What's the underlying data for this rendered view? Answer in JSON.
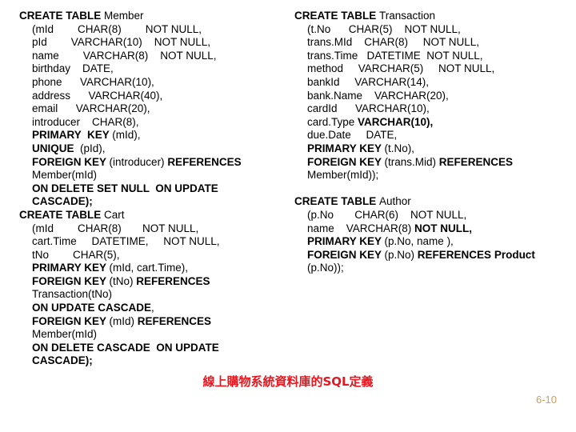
{
  "slide": {
    "caption": "線上購物系統資料庫的SQL定義",
    "page_number": "6-10",
    "caption_color": "#e8171f",
    "page_number_color": "#c8a060",
    "left_column": [
      {
        "indent": 0,
        "bold": "CREATE TABLE ",
        "normal": "Member"
      },
      {
        "indent": 1,
        "bold": "",
        "normal": "(mId        CHAR(8)        NOT NULL,"
      },
      {
        "indent": 1,
        "bold": "",
        "normal": "pId        VARCHAR(10)    NOT NULL,"
      },
      {
        "indent": 1,
        "bold": "",
        "normal": "name        VARCHAR(8)    NOT NULL,"
      },
      {
        "indent": 1,
        "bold": "",
        "normal": "birthday    DATE,"
      },
      {
        "indent": 1,
        "bold": "",
        "normal": "phone      VARCHAR(10),"
      },
      {
        "indent": 1,
        "bold": "",
        "normal": "address      VARCHAR(40),"
      },
      {
        "indent": 1,
        "bold": "",
        "normal": "email      VARCHAR(20),"
      },
      {
        "indent": 1,
        "bold": "",
        "normal": "introducer    CHAR(8),"
      },
      {
        "indent": 1,
        "bold": "PRIMARY  KEY ",
        "normal": "(mId),"
      },
      {
        "indent": 1,
        "bold": "UNIQUE ",
        "normal": " (pId),"
      },
      {
        "indent": 1,
        "bold": "FOREIGN KEY ",
        "normal": "(introducer) ",
        "bold2": "REFERENCES"
      },
      {
        "indent": 1,
        "bold": "",
        "normal": "Member(mId)"
      },
      {
        "indent": 1,
        "bold": "ON DELETE SET NULL  ON UPDATE",
        "normal": ""
      },
      {
        "indent": 1,
        "bold": "CASCADE);",
        "normal": ""
      },
      {
        "indent": 0,
        "bold": "CREATE TABLE ",
        "normal": "Cart"
      },
      {
        "indent": 1,
        "bold": "",
        "normal": "(mId        CHAR(8)       NOT NULL,"
      },
      {
        "indent": 1,
        "bold": "",
        "normal": "cart.Time     DATETIME,     NOT NULL,"
      },
      {
        "indent": 1,
        "bold": "",
        "normal": "tNo        CHAR(5),"
      },
      {
        "indent": 1,
        "bold": "PRIMARY KEY ",
        "normal": "(mId, cart.Time),"
      },
      {
        "indent": 1,
        "bold": "FOREIGN KEY ",
        "normal": "(tNo) ",
        "bold2": "REFERENCES"
      },
      {
        "indent": 1,
        "bold": "",
        "normal": "Transaction(tNo)"
      },
      {
        "indent": 1,
        "bold": "ON UPDATE CASCADE",
        "normal": ","
      },
      {
        "indent": 1,
        "bold": "FOREIGN KEY ",
        "normal": "(mId) ",
        "bold2": "REFERENCES"
      },
      {
        "indent": 1,
        "bold": "",
        "normal": "Member(mId)"
      },
      {
        "indent": 1,
        "bold": "ON DELETE CASCADE  ON UPDATE",
        "normal": ""
      },
      {
        "indent": 1,
        "bold": "CASCADE);",
        "normal": ""
      }
    ],
    "right_column": [
      {
        "indent": 0,
        "bold": "CREATE TABLE ",
        "normal": "Transaction"
      },
      {
        "indent": 1,
        "bold": "",
        "normal": "(t.No      CHAR(5)    NOT NULL,"
      },
      {
        "indent": 1,
        "bold": "",
        "normal": "trans.MId    CHAR(8)     NOT NULL,"
      },
      {
        "indent": 1,
        "bold": "",
        "normal": "trans.Time   DATETIME  NOT NULL,"
      },
      {
        "indent": 1,
        "bold": "",
        "normal": "method     VARCHAR(5)     NOT NULL,"
      },
      {
        "indent": 1,
        "bold": "",
        "normal": "bankId     VARCHAR(14),"
      },
      {
        "indent": 1,
        "bold": "",
        "normal": "bank.Name    VARCHAR(20),"
      },
      {
        "indent": 1,
        "bold": "",
        "normal": "cardId      VARCHAR(10),"
      },
      {
        "indent": 1,
        "bold": "",
        "normal": "card.Type ",
        "bold2": "VARCHAR(10),"
      },
      {
        "indent": 1,
        "bold": "",
        "normal": "due.Date     DATE,"
      },
      {
        "indent": 1,
        "bold": "PRIMARY KEY ",
        "normal": "(t.No),"
      },
      {
        "indent": 1,
        "bold": "FOREIGN KEY ",
        "normal": "(trans.Mid) ",
        "bold2": "REFERENCES"
      },
      {
        "indent": 1,
        "bold": "",
        "normal": "Member(mId));"
      },
      {
        "indent": 0,
        "bold": "",
        "normal": ""
      },
      {
        "indent": 0,
        "bold": "CREATE TABLE ",
        "normal": "Author"
      },
      {
        "indent": 1,
        "bold": "",
        "normal": "(p.No       CHAR(6)    NOT NULL,"
      },
      {
        "indent": 1,
        "bold": "",
        "normal": "name    VARCHAR(8) ",
        "bold2": "NOT NULL,"
      },
      {
        "indent": 1,
        "bold": "PRIMARY KEY ",
        "normal": "(p.No, name ),"
      },
      {
        "indent": 1,
        "bold": "FOREIGN KEY ",
        "normal": "(p.No) ",
        "bold2": "REFERENCES Product"
      },
      {
        "indent": 1,
        "bold": "",
        "normal": "(p.No));"
      }
    ]
  }
}
